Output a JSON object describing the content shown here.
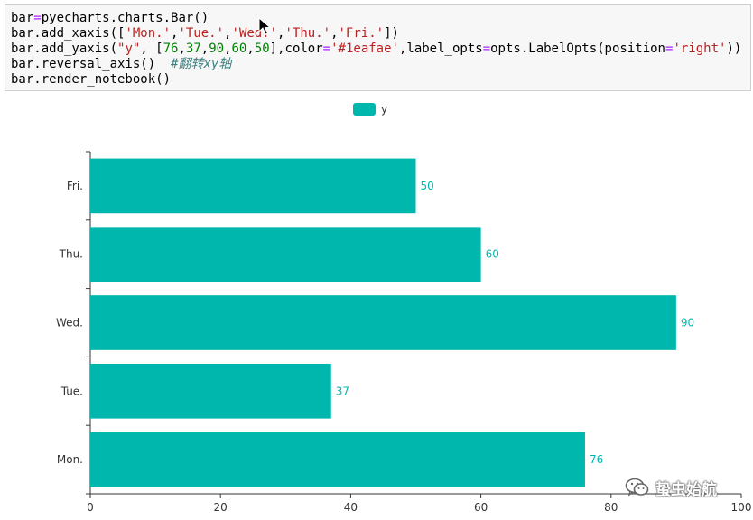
{
  "code": {
    "lines": [
      [
        {
          "t": "bar",
          "c": "plain"
        },
        {
          "t": "=",
          "c": "op"
        },
        {
          "t": "pyecharts.charts.Bar()",
          "c": "plain"
        }
      ],
      [
        {
          "t": "bar.add_xaxis([",
          "c": "plain"
        },
        {
          "t": "'Mon.'",
          "c": "str"
        },
        {
          "t": ",",
          "c": "plain"
        },
        {
          "t": "'Tue.'",
          "c": "str"
        },
        {
          "t": ",",
          "c": "plain"
        },
        {
          "t": "'Wed.'",
          "c": "str"
        },
        {
          "t": ",",
          "c": "plain"
        },
        {
          "t": "'Thu.'",
          "c": "str"
        },
        {
          "t": ",",
          "c": "plain"
        },
        {
          "t": "'Fri.'",
          "c": "str"
        },
        {
          "t": "])",
          "c": "plain"
        }
      ],
      [
        {
          "t": "bar.add_yaxis(",
          "c": "plain"
        },
        {
          "t": "\"y\"",
          "c": "str"
        },
        {
          "t": ", [",
          "c": "plain"
        },
        {
          "t": "76",
          "c": "num"
        },
        {
          "t": ",",
          "c": "plain"
        },
        {
          "t": "37",
          "c": "num"
        },
        {
          "t": ",",
          "c": "plain"
        },
        {
          "t": "90",
          "c": "num"
        },
        {
          "t": ",",
          "c": "plain"
        },
        {
          "t": "60",
          "c": "num"
        },
        {
          "t": ",",
          "c": "plain"
        },
        {
          "t": "50",
          "c": "num"
        },
        {
          "t": "],color",
          "c": "plain"
        },
        {
          "t": "=",
          "c": "op"
        },
        {
          "t": "'#1eafae'",
          "c": "str"
        },
        {
          "t": ",label_opts",
          "c": "plain"
        },
        {
          "t": "=",
          "c": "op"
        },
        {
          "t": "opts.LabelOpts(position",
          "c": "plain"
        },
        {
          "t": "=",
          "c": "op"
        },
        {
          "t": "'right'",
          "c": "str"
        },
        {
          "t": "))",
          "c": "plain"
        }
      ],
      [
        {
          "t": "bar.reversal_axis()  ",
          "c": "plain"
        },
        {
          "t": "#翻转xy轴",
          "c": "comment"
        }
      ],
      [
        {
          "t": "bar.render_notebook()",
          "c": "plain"
        }
      ]
    ],
    "colors": {
      "plain": "#000000",
      "op": "#aa22ff",
      "str": "#ba2121",
      "num": "#008000",
      "comment": "#408080"
    }
  },
  "chart_data": {
    "type": "bar",
    "orientation": "horizontal",
    "categories": [
      "Mon.",
      "Tue.",
      "Wed.",
      "Thu.",
      "Fri."
    ],
    "series": [
      {
        "name": "y",
        "values": [
          76,
          37,
          90,
          60,
          50
        ],
        "color": "#00b7ad"
      }
    ],
    "xlim": [
      0,
      100
    ],
    "xticks": [
      0,
      20,
      40,
      60,
      80,
      100
    ],
    "label_position": "right",
    "legend": "top-center",
    "grid": false,
    "axis_color": "#333333",
    "label_color": "#00b7ad"
  },
  "watermark": {
    "text": "蛰虫始航",
    "icon": "wechat-icon"
  }
}
